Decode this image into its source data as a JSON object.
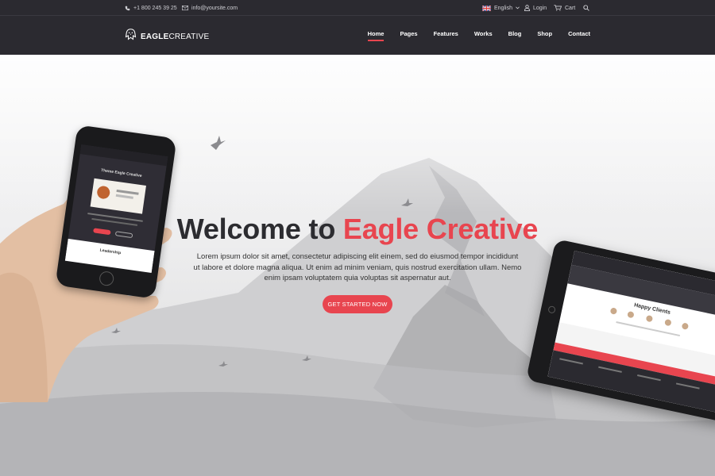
{
  "topbar": {
    "phone": "+1 800 245 39 25",
    "email": "info@yoursite.com",
    "language": "English",
    "login": "Login",
    "cart": "Cart"
  },
  "brand": {
    "name_bold": "EAGLE",
    "name_light": "CREATIVE"
  },
  "nav": {
    "items": [
      "Home",
      "Pages",
      "Features",
      "Works",
      "Blog",
      "Shop",
      "Contact"
    ],
    "active": "Home"
  },
  "hero": {
    "title_prefix": "Welcome to ",
    "title_accent": "Eagle Creative",
    "description_line1": "Lorem ipsum dolor sit amet, consectetur adipiscing elit einem, sed do eiusmod tempor incididunt",
    "description_line2": "ut labore et dolore magna aliqua. Ut enim ad minim veniam, quis nostrud exercitation ullam. Nemo",
    "description_line3": "enim ipsam voluptatem quia voluptas sit aspernatur aut.",
    "cta": "GET STARTED NOW"
  },
  "mockups": {
    "phone_title": "Theme Eagle Creative",
    "phone_section": "Leadership",
    "tablet_title": "Happy Clients"
  },
  "colors": {
    "accent": "#e8454f",
    "dark": "#2b2a30",
    "title_text": "#2c2c30"
  },
  "icons": {
    "phone": "phone-icon",
    "email": "envelope-icon",
    "flag": "uk-flag-icon",
    "chevron": "chevron-down-icon",
    "login": "user-icon",
    "cart": "cart-icon",
    "search": "search-icon",
    "logo": "eagle-logo-icon"
  }
}
